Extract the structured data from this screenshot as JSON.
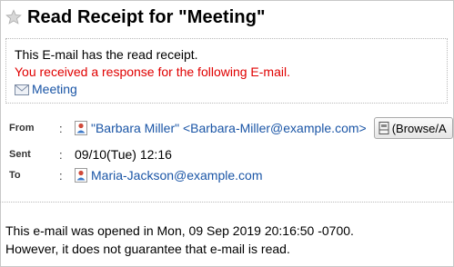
{
  "window": {
    "title": "Read Receipt for \"Meeting\""
  },
  "notice": {
    "line1": "This E-mail has the read receipt.",
    "line2": "You received a response for the following E-mail.",
    "link_label": "Meeting"
  },
  "fields": {
    "from_label": "From",
    "from_value": "\"Barbara Miller\" <Barbara-Miller@example.com>",
    "browse_label": "(Browse/A",
    "sent_label": "Sent",
    "sent_value": "09/10(Tue) 12:16",
    "to_label": "To",
    "to_value": "Maria-Jackson@example.com",
    "colon": ":"
  },
  "message": {
    "line1": "This e-mail was opened in Mon, 09 Sep 2019 20:16:50 -0700.",
    "line2": "However, it does not guarantee that e-mail is read."
  },
  "icons": {
    "star": "star-icon",
    "envelope": "envelope-icon",
    "user": "user-icon",
    "addressbook": "address-book-icon"
  },
  "colors": {
    "link": "#1a55a6",
    "alert": "#e00000",
    "border": "#c8c8c8"
  }
}
